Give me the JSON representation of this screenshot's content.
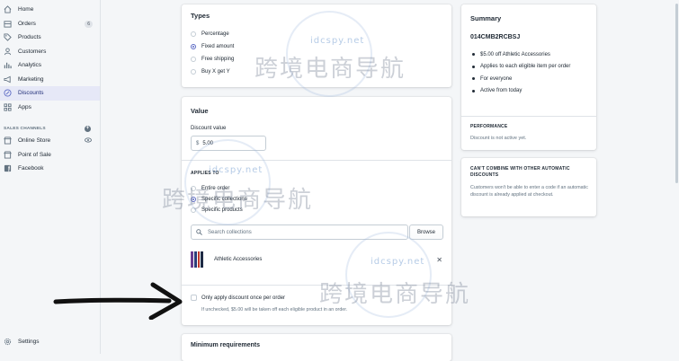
{
  "sidebar": {
    "items": [
      {
        "label": "Home",
        "icon": "home-icon"
      },
      {
        "label": "Orders",
        "icon": "orders-icon",
        "badge": "6"
      },
      {
        "label": "Products",
        "icon": "tag-icon"
      },
      {
        "label": "Customers",
        "icon": "person-icon"
      },
      {
        "label": "Analytics",
        "icon": "bar-chart-icon"
      },
      {
        "label": "Marketing",
        "icon": "megaphone-icon"
      },
      {
        "label": "Discounts",
        "icon": "discount-icon",
        "active": true
      },
      {
        "label": "Apps",
        "icon": "apps-icon"
      }
    ],
    "sales_channels_heading": "SALES CHANNELS",
    "channels": [
      {
        "label": "Online Store",
        "icon": "store-icon"
      },
      {
        "label": "Point of Sale",
        "icon": "pos-icon"
      },
      {
        "label": "Facebook",
        "icon": "facebook-icon"
      }
    ],
    "settings_label": "Settings"
  },
  "types_card": {
    "title": "Types",
    "options": [
      "Percentage",
      "Fixed amount",
      "Free shipping",
      "Buy X get Y"
    ],
    "selected_index": 1
  },
  "value_card": {
    "title": "Value",
    "discount_value_label": "Discount value",
    "currency": "$",
    "amount": "5.00",
    "applies_to_heading": "APPLIES TO",
    "applies_options": [
      "Entire order",
      "Specific collections",
      "Specific products"
    ],
    "applies_selected_index": 1,
    "search_placeholder": "Search collections",
    "browse_label": "Browse",
    "collection_name": "Athletic Accessories",
    "once_per_order_label": "Only apply discount once per order",
    "once_per_order_help": "If unchecked, $5.00 will be taken off each eligible product in an order."
  },
  "min_req_card": {
    "title": "Minimum requirements"
  },
  "summary_card": {
    "title": "Summary",
    "code": "014CMB2RCBSJ",
    "bullets": [
      "$5.00 off Athletic Accessories",
      "Applies to each eligible item per order",
      "For everyone",
      "Active from today"
    ],
    "performance_heading": "PERFORMANCE",
    "performance_text": "Discount is not active yet."
  },
  "combine_card": {
    "heading": "CAN'T COMBINE WITH OTHER AUTOMATIC DISCOUNTS",
    "text": "Customers won't be able to enter a code if an automatic discount is already applied at checkout."
  },
  "watermark": {
    "url": "idcspy.net",
    "text": "跨境电商导航"
  },
  "colors": {
    "accent": "#5c6ac4",
    "active_nav_bg": "#e6e8f7",
    "page_bg": "#f4f6f8"
  }
}
